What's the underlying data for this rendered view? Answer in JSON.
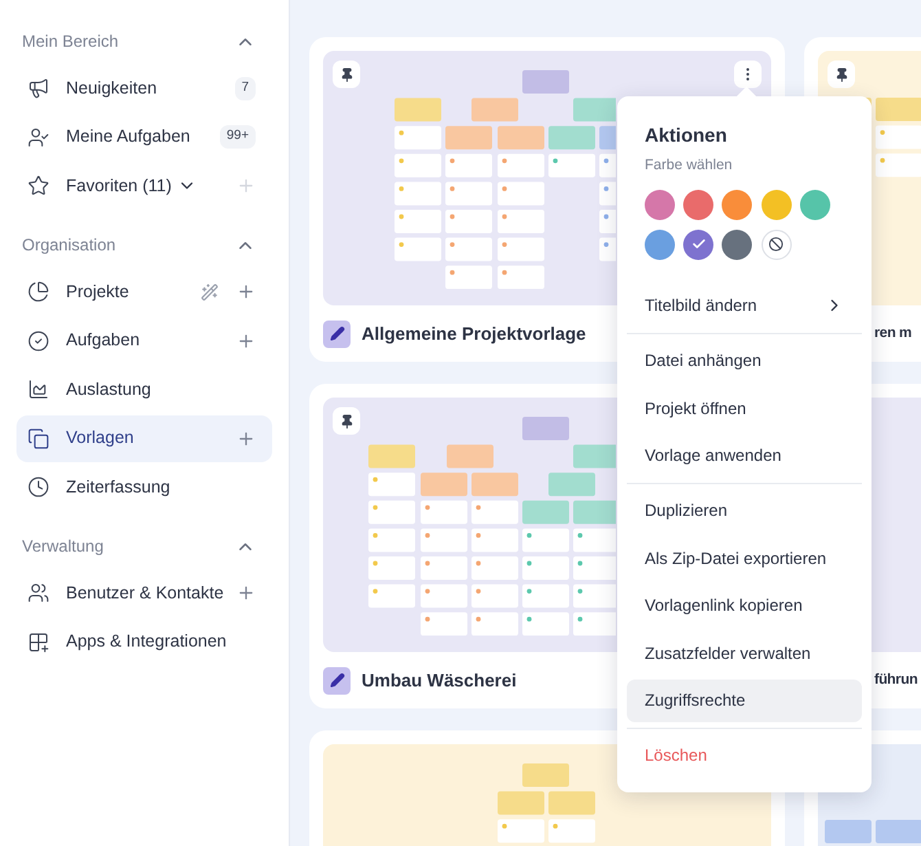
{
  "sidebar": {
    "sections": [
      {
        "title": "Mein Bereich",
        "expanded": true,
        "items": [
          {
            "label": "Neuigkeiten",
            "badge": "7",
            "selected": false
          },
          {
            "label": "Meine Aufgaben",
            "badge": "99+",
            "selected": false
          },
          {
            "label": "Favoriten (11)",
            "dropdown": true,
            "add": true,
            "add_disabled": true,
            "selected": false
          }
        ]
      },
      {
        "title": "Organisation",
        "expanded": true,
        "items": [
          {
            "label": "Projekte",
            "magic": true,
            "add": true,
            "selected": false
          },
          {
            "label": "Aufgaben",
            "add": true,
            "selected": false
          },
          {
            "label": "Auslastung",
            "selected": false
          },
          {
            "label": "Vorlagen",
            "add": true,
            "selected": true
          },
          {
            "label": "Zeiterfassung",
            "selected": false
          }
        ]
      },
      {
        "title": "Verwaltung",
        "expanded": true,
        "items": [
          {
            "label": "Benutzer & Kontakte",
            "add": true,
            "selected": false
          },
          {
            "label": "Apps & Integrationen",
            "selected": false
          }
        ]
      }
    ]
  },
  "cards": [
    {
      "title": "Allgemeine Projektvorlage",
      "color": "#e8e7f6",
      "pin": true,
      "menu_open": true
    },
    {
      "title": "ren m",
      "color": "#fdf3dc",
      "pin": true,
      "menu_open": false
    },
    {
      "title": "Umbau Wäscherei",
      "color": "#e8e7f6",
      "pin": true,
      "menu_open": false
    },
    {
      "title": "führun",
      "color": "#e9e8f6",
      "pin": false,
      "menu_open": false
    },
    {
      "color": "#fdf2d9",
      "pin": false,
      "menu_open": false
    },
    {
      "color": "#e6ecf8",
      "pin": false,
      "menu_open": false
    }
  ],
  "menu": {
    "title": "Aktionen",
    "subtitle": "Farbe wählen",
    "swatches": [
      {
        "kind": "color",
        "color": "#d577a9",
        "selected": false
      },
      {
        "kind": "color",
        "color": "#e96b6b",
        "selected": false
      },
      {
        "kind": "color",
        "color": "#f98d3a",
        "selected": false
      },
      {
        "kind": "color",
        "color": "#f3c024",
        "selected": false
      },
      {
        "kind": "color",
        "color": "#56c4a9",
        "selected": false
      },
      {
        "kind": "color",
        "color": "#6a9fe0",
        "selected": false
      },
      {
        "kind": "color",
        "color": "#7e72cf",
        "selected": true
      },
      {
        "kind": "color",
        "color": "#67717e",
        "selected": false
      },
      {
        "kind": "none",
        "selected": false
      }
    ],
    "groups": [
      {
        "items": [
          {
            "label": "Titelbild ändern",
            "kind": "submenu",
            "selected": false
          }
        ]
      },
      {
        "items": [
          {
            "label": "Datei anhängen",
            "kind": "item",
            "selected": false
          },
          {
            "label": "Projekt öffnen",
            "kind": "item",
            "selected": false
          },
          {
            "label": "Vorlage anwenden",
            "kind": "item",
            "selected": false
          }
        ]
      },
      {
        "items": [
          {
            "label": "Duplizieren",
            "kind": "item",
            "selected": false
          },
          {
            "label": "Als Zip-Datei exportieren",
            "kind": "item",
            "selected": false
          },
          {
            "label": "Vorlagenlink kopieren",
            "kind": "item",
            "selected": false
          },
          {
            "label": "Zusatzfelder verwalten",
            "kind": "item",
            "selected": false
          },
          {
            "label": "Zugriffsrechte",
            "kind": "item",
            "selected": true
          }
        ]
      },
      {
        "items": [
          {
            "label": "Löschen",
            "kind": "danger",
            "selected": false
          }
        ]
      }
    ]
  }
}
